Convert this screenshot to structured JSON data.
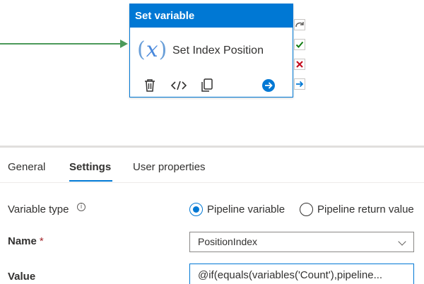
{
  "activity": {
    "type_label": "Set variable",
    "name": "Set Index Position",
    "icon": "fx-variable-icon",
    "accent_color": "#0078d4",
    "actions": [
      "delete-icon",
      "code-icon",
      "copy-icon",
      "arrow-right-circle-icon"
    ],
    "output_ports": [
      "skip-icon",
      "success-check-icon",
      "failure-x-icon",
      "completion-arrow-icon"
    ]
  },
  "tabs": [
    {
      "label": "General",
      "active": false
    },
    {
      "label": "Settings",
      "active": true
    },
    {
      "label": "User properties",
      "active": false
    }
  ],
  "form": {
    "variable_type": {
      "label": "Variable type",
      "options": [
        {
          "label": "Pipeline variable",
          "checked": true
        },
        {
          "label": "Pipeline return value",
          "checked": false
        }
      ]
    },
    "name": {
      "label": "Name",
      "required_marker": "*",
      "value": "PositionIndex"
    },
    "value": {
      "label": "Value",
      "value": "@if(equals(variables('Count'),pipeline..."
    }
  }
}
